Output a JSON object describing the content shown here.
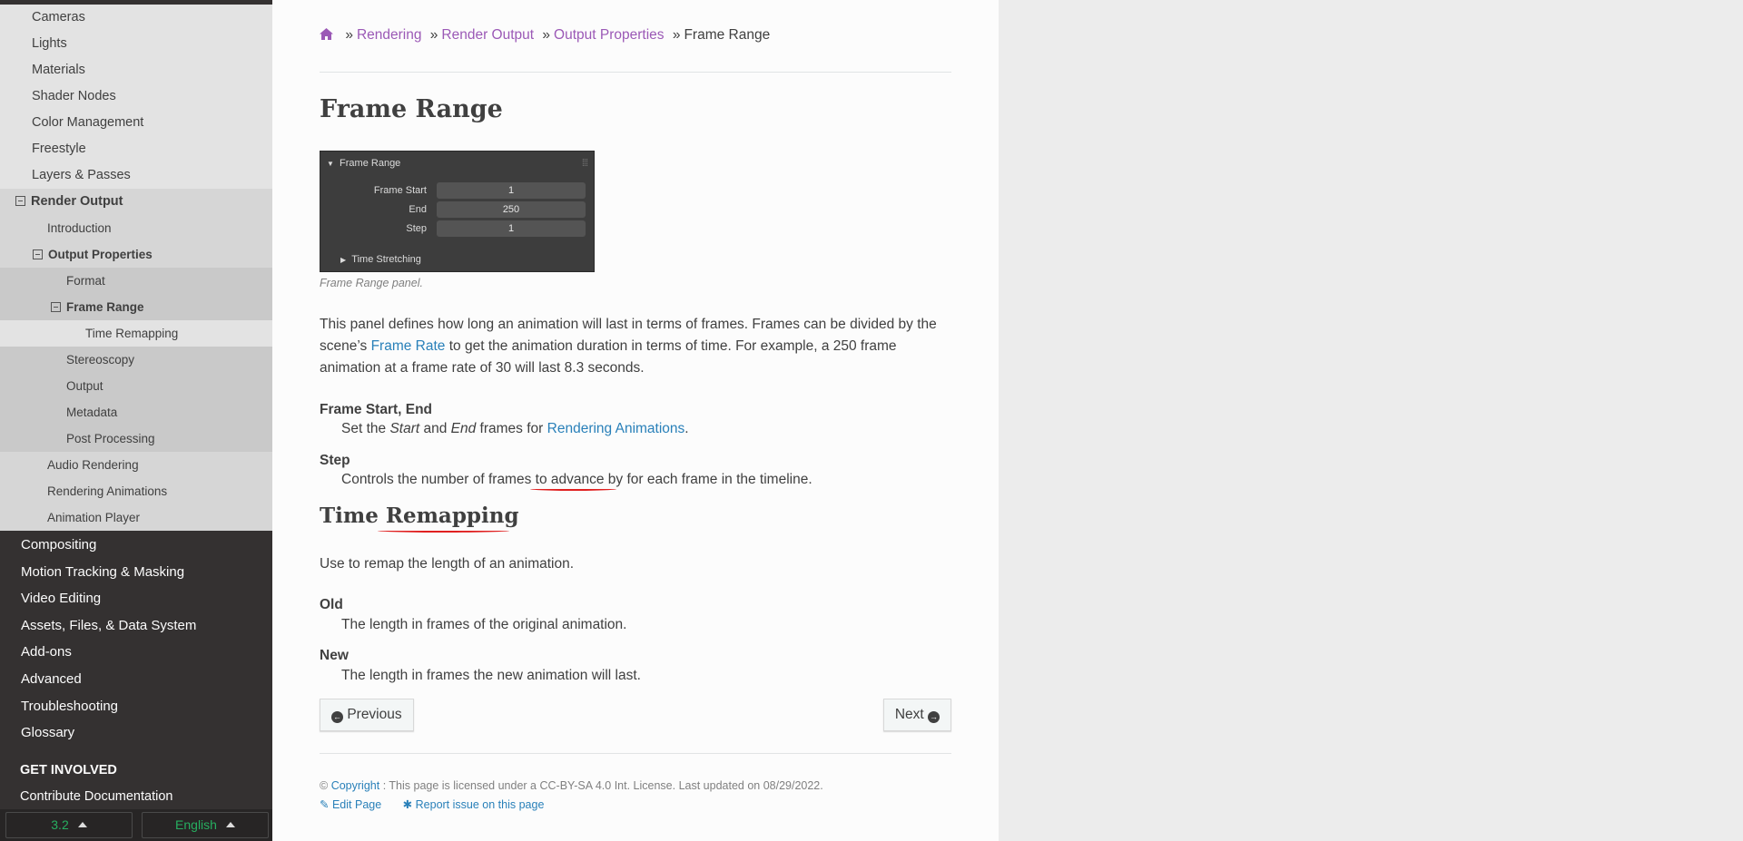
{
  "sidebar": {
    "top_items": [
      "Cameras",
      "Lights",
      "Materials",
      "Shader Nodes",
      "Color Management",
      "Freestyle",
      "Layers & Passes"
    ],
    "render_output": "Render Output",
    "introduction": "Introduction",
    "output_properties": "Output Properties",
    "format": "Format",
    "frame_range": "Frame Range",
    "time_remapping": "Time Remapping",
    "after_frame_range": [
      "Stereoscopy",
      "Output",
      "Metadata",
      "Post Processing"
    ],
    "after_output_props": [
      "Audio Rendering",
      "Rendering Animations",
      "Animation Player"
    ],
    "dark_items": [
      "Compositing",
      "Motion Tracking & Masking",
      "Video Editing",
      "Assets, Files, & Data System",
      "Add-ons",
      "Advanced",
      "Troubleshooting",
      "Glossary"
    ],
    "get_involved": "GET INVOLVED",
    "contribute": "Contribute Documentation",
    "version": "3.2",
    "language": "English"
  },
  "breadcrumb": {
    "items": [
      "Rendering",
      "Render Output",
      "Output Properties"
    ],
    "current": "Frame Range",
    "separator": "»"
  },
  "page": {
    "title": "Frame Range",
    "caption": "Frame Range panel.",
    "intro_1": "This panel defines how long an animation will last in terms of frames. Frames can be divided by the scene’s ",
    "intro_link": "Frame Rate",
    "intro_2": " to get the animation duration in terms of time. For example, a 250 frame animation at a frame rate of 30 will last 8.3 seconds.",
    "fse_term": "Frame Start, End",
    "fse_desc_1": "Set the ",
    "fse_start": "Start",
    "fse_and": " and ",
    "fse_end": "End",
    "fse_desc_2": " frames for ",
    "fse_link": "Rendering Animations",
    "fse_period": ".",
    "step_term": "Step",
    "step_desc": "Controls the number of frames to advance by for each frame in the timeline.",
    "section2_title": "Time Remapping",
    "section2_intro": "Use to remap the length of an animation.",
    "old_term": "Old",
    "old_desc": "The length in frames of the original animation.",
    "new_term": "New",
    "new_desc": "The length in frames the new animation will last."
  },
  "panel": {
    "title": "Frame Range",
    "rows": [
      {
        "label": "Frame Start",
        "value": "1"
      },
      {
        "label": "End",
        "value": "250"
      },
      {
        "label": "Step",
        "value": "1"
      }
    ],
    "subpanel": "Time Stretching"
  },
  "nav": {
    "previous": "Previous",
    "next": "Next"
  },
  "footer": {
    "copyright_symbol": "©",
    "copyright_link": "Copyright",
    "license_text": ": This page is licensed under a CC-BY-SA 4.0 Int. License. Last updated on 08/29/2022.",
    "edit_page": "Edit Page",
    "report_issue": "Report issue on this page"
  },
  "colors": {
    "link": "#2980b9",
    "visited": "#9b59b6",
    "sidebar_dark": "#343131",
    "version_green": "#27ae60",
    "annotation": "#e02020"
  }
}
